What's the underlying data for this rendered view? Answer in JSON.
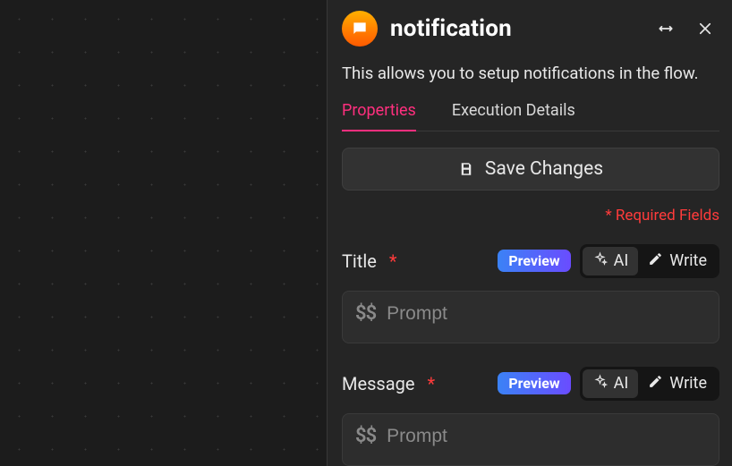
{
  "header": {
    "title": "notification",
    "description": "This allows you to setup notifications in the flow."
  },
  "tabs": {
    "properties": "Properties",
    "execution": "Execution Details",
    "active": "properties"
  },
  "actions": {
    "save": "Save Changes",
    "required_note": "* Required Fields",
    "preview": "Preview",
    "ai": "AI",
    "write": "Write"
  },
  "fields": {
    "title": {
      "label": "Title",
      "placeholder": "Prompt",
      "value": "",
      "mode": "ai"
    },
    "message": {
      "label": "Message",
      "placeholder": "Prompt",
      "value": "",
      "mode": "ai"
    }
  },
  "icons": {
    "variable_token": "$$"
  }
}
